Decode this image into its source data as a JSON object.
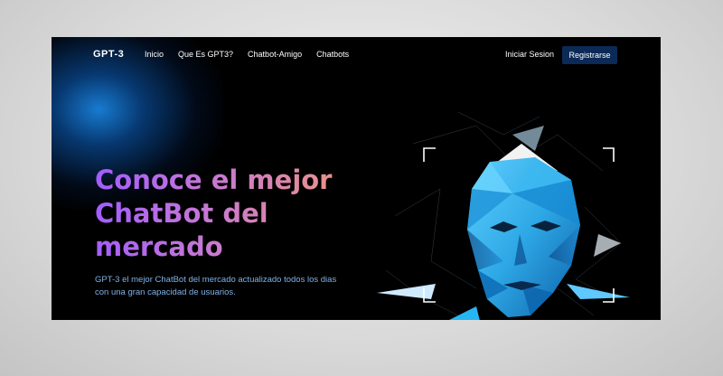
{
  "nav": {
    "logo": "GPT-3",
    "links": [
      "Inicio",
      "Que Es GPT3?",
      "Chatbot-Amigo",
      "Chatbots"
    ],
    "login": "Iniciar Sesion",
    "register": "Registrarse"
  },
  "hero": {
    "title": "Conoce el mejor ChatBot del mercado",
    "subtitle": "GPT-3 el mejor ChatBot del mercado actualizado todos los dias con una gran capacidad de usuarios."
  },
  "colors": {
    "background": "#000000",
    "register_button": "#0b2a57",
    "title_gradient": [
      "#a25cff",
      "#f59a72"
    ],
    "subtitle": "#7fb2e8",
    "face": "#2ea8e6"
  },
  "illustration": {
    "icon": "ai-face-polygon-icon"
  }
}
